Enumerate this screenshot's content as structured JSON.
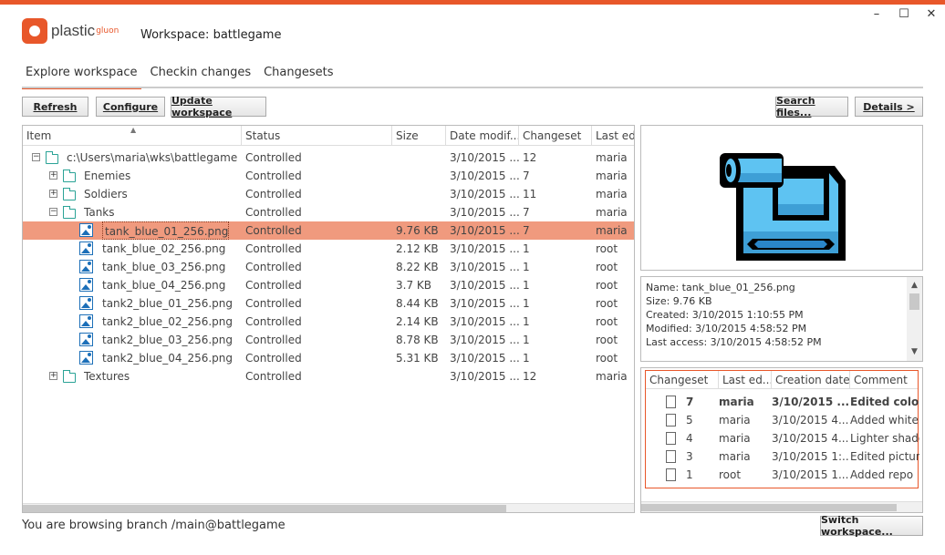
{
  "window": {
    "controls": [
      "–",
      "☐",
      "✕"
    ]
  },
  "app": {
    "logo_text": "plastic",
    "logo_sub": "gluon",
    "workspace_title": "Workspace: battlegame"
  },
  "tabs": [
    {
      "label": "Explore workspace",
      "active": true
    },
    {
      "label": "Checkin changes",
      "active": false
    },
    {
      "label": "Changesets",
      "active": false
    }
  ],
  "toolbar": {
    "refresh": "Refresh",
    "configure": "Configure",
    "update_workspace": "Update workspace",
    "search_files": "Search files...",
    "details": "Details >"
  },
  "explorer": {
    "columns": [
      "Item",
      "Status",
      "Size",
      "Date modif...",
      "Changeset",
      "Last edi"
    ],
    "rows": [
      {
        "name": "c:\\Users\\maria\\wks\\battlegame",
        "status": "Controlled",
        "size": "",
        "date": "3/10/2015 ...",
        "changeset": "12",
        "last": "maria",
        "type": "folder",
        "expander": "−",
        "depth": 0,
        "selected": false
      },
      {
        "name": "Enemies",
        "status": "Controlled",
        "size": "",
        "date": "3/10/2015 ...",
        "changeset": "7",
        "last": "maria",
        "type": "folder",
        "expander": "+",
        "depth": 1,
        "selected": false
      },
      {
        "name": "Soldiers",
        "status": "Controlled",
        "size": "",
        "date": "3/10/2015 ...",
        "changeset": "11",
        "last": "maria",
        "type": "folder",
        "expander": "+",
        "depth": 1,
        "selected": false
      },
      {
        "name": "Tanks",
        "status": "Controlled",
        "size": "",
        "date": "3/10/2015 ...",
        "changeset": "7",
        "last": "maria",
        "type": "folder",
        "expander": "−",
        "depth": 1,
        "selected": false
      },
      {
        "name": "tank_blue_01_256.png",
        "status": "Controlled",
        "size": "9.76 KB",
        "date": "3/10/2015 ...",
        "changeset": "7",
        "last": "maria",
        "type": "image",
        "expander": "",
        "depth": 2,
        "selected": true
      },
      {
        "name": "tank_blue_02_256.png",
        "status": "Controlled",
        "size": "2.12 KB",
        "date": "3/10/2015 ...",
        "changeset": "1",
        "last": "root",
        "type": "image",
        "expander": "",
        "depth": 2,
        "selected": false
      },
      {
        "name": "tank_blue_03_256.png",
        "status": "Controlled",
        "size": "8.22 KB",
        "date": "3/10/2015 ...",
        "changeset": "1",
        "last": "root",
        "type": "image",
        "expander": "",
        "depth": 2,
        "selected": false
      },
      {
        "name": "tank_blue_04_256.png",
        "status": "Controlled",
        "size": "3.7 KB",
        "date": "3/10/2015 ...",
        "changeset": "1",
        "last": "root",
        "type": "image",
        "expander": "",
        "depth": 2,
        "selected": false
      },
      {
        "name": "tank2_blue_01_256.png",
        "status": "Controlled",
        "size": "8.44 KB",
        "date": "3/10/2015 ...",
        "changeset": "1",
        "last": "root",
        "type": "image",
        "expander": "",
        "depth": 2,
        "selected": false
      },
      {
        "name": "tank2_blue_02_256.png",
        "status": "Controlled",
        "size": "2.14 KB",
        "date": "3/10/2015 ...",
        "changeset": "1",
        "last": "root",
        "type": "image",
        "expander": "",
        "depth": 2,
        "selected": false
      },
      {
        "name": "tank2_blue_03_256.png",
        "status": "Controlled",
        "size": "8.78 KB",
        "date": "3/10/2015 ...",
        "changeset": "1",
        "last": "root",
        "type": "image",
        "expander": "",
        "depth": 2,
        "selected": false
      },
      {
        "name": "tank2_blue_04_256.png",
        "status": "Controlled",
        "size": "5.31 KB",
        "date": "3/10/2015 ...",
        "changeset": "1",
        "last": "root",
        "type": "image",
        "expander": "",
        "depth": 2,
        "selected": false
      },
      {
        "name": "Textures",
        "status": "Controlled",
        "size": "",
        "date": "3/10/2015 ...",
        "changeset": "12",
        "last": "maria",
        "type": "folder",
        "expander": "+",
        "depth": 1,
        "selected": false
      }
    ]
  },
  "file_info": {
    "lines": [
      "Name: tank_blue_01_256.png",
      "Size: 9.76 KB",
      "Created: 3/10/2015 1:10:55 PM",
      "Modified: 3/10/2015 4:58:52 PM",
      "Last access: 3/10/2015 4:58:52 PM"
    ]
  },
  "history": {
    "columns": [
      "Changeset",
      "Last ed...",
      "Creation date",
      "Comment"
    ],
    "rows": [
      {
        "changeset": "7",
        "user": "maria",
        "date": "3/10/2015 ...",
        "comment": "Edited colors",
        "bold": true
      },
      {
        "changeset": "5",
        "user": "maria",
        "date": "3/10/2015 4...",
        "comment": "Added white li",
        "bold": false
      },
      {
        "changeset": "4",
        "user": "maria",
        "date": "3/10/2015 4...",
        "comment": "Lighter shadow",
        "bold": false
      },
      {
        "changeset": "3",
        "user": "maria",
        "date": "3/10/2015 1:...",
        "comment": "Edited pictures",
        "bold": false
      },
      {
        "changeset": "1",
        "user": "root",
        "date": "3/10/2015 1...",
        "comment": "Added repo",
        "bold": false
      }
    ]
  },
  "status_bar": {
    "text": "You are browsing branch /main@battlegame",
    "switch_button": "Switch workspace..."
  },
  "colors": {
    "accent": "#e8572a",
    "selection": "#f09a7e",
    "folder": "#2aa396",
    "image_icon": "#1c6fb8",
    "preview_tank": "#5ec3f2"
  }
}
